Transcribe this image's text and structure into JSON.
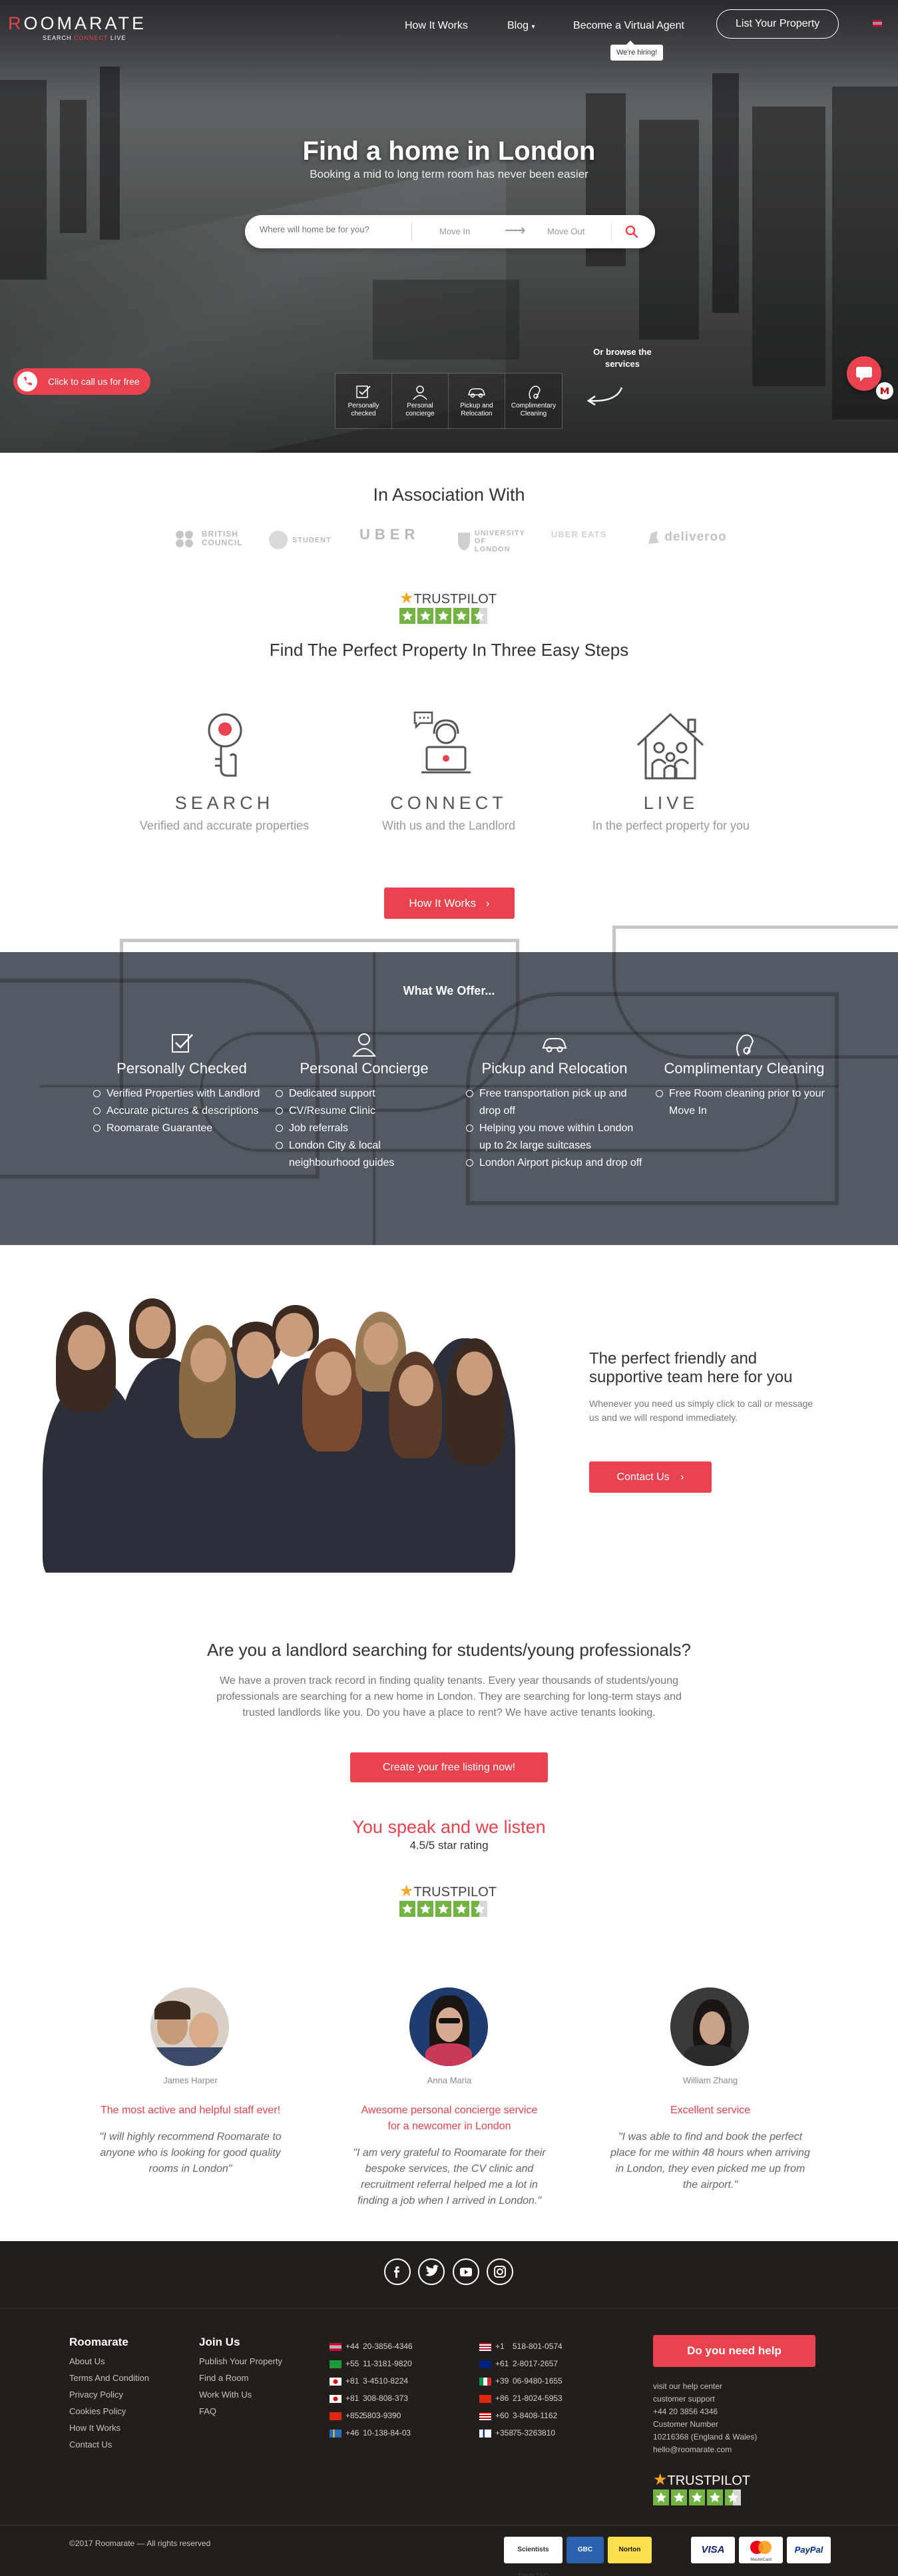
{
  "brand": {
    "logo_first": "R",
    "logo_rest": "OOMARATE",
    "tagline_a": "SEARCH",
    "tagline_b": "CONNECT",
    "tagline_c": "LIVE"
  },
  "nav": {
    "how": "How It Works",
    "blog": "Blog",
    "agent": "Become a Virtual Agent",
    "list": "List Your Property",
    "hiring": "We're hiring!"
  },
  "hero": {
    "title": "Find a home in London",
    "subtitle": "Booking a mid to long term room has never been easier",
    "search_placeholder": "Where will home be for you?",
    "move_in": "Move In",
    "move_out": "Move Out",
    "call_label": "Click to call us for free",
    "browse_label": "Or browse the services",
    "services": [
      "Personally checked",
      "Personal concierge",
      "Pickup and Relocation",
      "Complimentary Cleaning"
    ]
  },
  "association": {
    "title": "In Association With",
    "partners": [
      "BRITISH COUNCIL",
      "STUDENT",
      "UBER",
      "UNIVERSITY OF LONDON",
      "UBER EATS",
      "deliveroo"
    ]
  },
  "trustpilot": {
    "label": "TRUSTPILOT",
    "stars": 4.5
  },
  "steps": {
    "title": "Find The Perfect Property In Three Easy Steps",
    "items": [
      {
        "title": "SEARCH",
        "desc": "Verified and accurate properties"
      },
      {
        "title": "CONNECT",
        "desc": "With us and the Landlord"
      },
      {
        "title": "LIVE",
        "desc": "In the perfect property for you"
      }
    ],
    "button": "How It Works"
  },
  "offer": {
    "title": "What We Offer...",
    "cols": [
      {
        "title": "Personally Checked",
        "items": [
          "Verified Properties with Landlord",
          "Accurate pictures & descriptions",
          "Roomarate Guarantee"
        ]
      },
      {
        "title": "Personal Concierge",
        "items": [
          "Dedicated support",
          "CV/Resume Clinic",
          "Job referrals",
          "London City & local neighbourhood guides"
        ]
      },
      {
        "title": "Pickup and Relocation",
        "items": [
          "Free transportation pick up and drop off",
          "Helping you move within London up to 2x large suitcases",
          "London Airport pickup and drop off"
        ]
      },
      {
        "title": "Complimentary Cleaning",
        "items": [
          "Free Room cleaning prior to your Move In"
        ]
      }
    ]
  },
  "team": {
    "title": "The perfect friendly and supportive team here for you",
    "text": "Whenever you need us simply click to call or message us and we will respond immediately.",
    "button": "Contact Us"
  },
  "landlord": {
    "title": "Are you a landlord searching for students/young professionals?",
    "text": "We have a proven track record in finding quality tenants. Every year thousands of students/young professionals are searching for a new home in London. They are searching for long-term stays and trusted landlords like you. Do you have a place to rent? We have active tenants looking.",
    "button": "Create your free listing now!"
  },
  "listen": {
    "title": "You speak and we listen",
    "rating": "4.5/5 star rating"
  },
  "reviews": [
    {
      "name": "James Harper",
      "headline": "The most active and helpful staff ever!",
      "text": "\"I will highly recommend Roomarate to anyone who is looking for good quality rooms in London\""
    },
    {
      "name": "Anna Maria",
      "headline": "Awesome personal concierge service for a newcomer in London",
      "text": "\"I am very grateful to Roomarate for their bespoke services, the CV clinic and recruitment referral helped me a lot in finding a job when I arrived in London.\""
    },
    {
      "name": "William Zhang",
      "headline": "Excellent service",
      "text": "\"I was able to find and book the perfect place for me within 48 hours when arriving in London, they even picked me up from the airport.\""
    }
  ],
  "footer": {
    "col1_title": "Roomarate",
    "col1": [
      "About Us",
      "Terms And Condition",
      "Privacy Policy",
      "Cookies Policy",
      "How It Works",
      "Contact Us"
    ],
    "col2_title": "Join Us",
    "col2": [
      "Publish Your Property",
      "Find a Room",
      "Work With Us",
      "FAQ"
    ],
    "phones_left": [
      {
        "cc": "+44",
        "num": "20-3856-4346"
      },
      {
        "cc": "+55",
        "num": "11-3181-9820"
      },
      {
        "cc": "+81",
        "num": "3-4510-8224"
      },
      {
        "cc": "+81",
        "num": "308-808-373"
      },
      {
        "cc": "+852",
        "num": "5803-9390"
      },
      {
        "cc": "+46",
        "num": "10-138-84-03"
      }
    ],
    "phones_right": [
      {
        "cc": "+1",
        "num": "518-801-0574"
      },
      {
        "cc": "+61",
        "num": "2-8017-2657"
      },
      {
        "cc": "+39",
        "num": "06-9480-1655"
      },
      {
        "cc": "+86",
        "num": "21-8024-5953"
      },
      {
        "cc": "+60",
        "num": "3-8408-1162"
      },
      {
        "cc": "+358",
        "num": "75-3263810"
      }
    ],
    "help_button": "Do you need help",
    "help_lines": [
      "visit our help center",
      "customer support",
      "+44 20 3856 4346",
      "Customer Number",
      "10216368 (England & Wales)",
      "hello@roomarate.com"
    ],
    "copyright": "©2017 Roomarate — All rights reserved",
    "badges": [
      "Scientists TRUSTED",
      "GBC",
      "Norton",
      "VISA",
      "MasterCard",
      "PayPal"
    ]
  }
}
